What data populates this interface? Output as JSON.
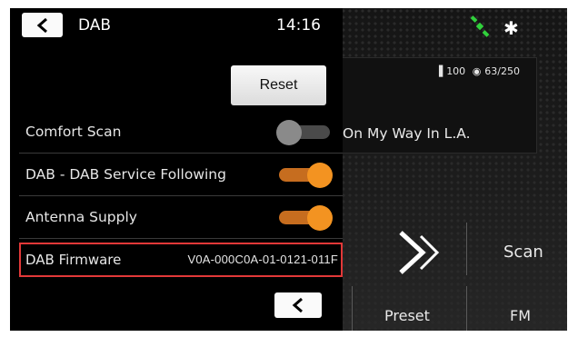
{
  "status_bar": {
    "title": "DAB",
    "time": "14:16"
  },
  "settings": {
    "reset_label": "Reset",
    "rows": [
      {
        "label": "Comfort Scan",
        "state": "off"
      },
      {
        "label": "DAB - DAB Service Following",
        "state": "on"
      },
      {
        "label": "Antenna Supply",
        "state": "on"
      }
    ],
    "firmware": {
      "label": "DAB Firmware",
      "value": "V0A-000C0A-01-0121-011F"
    }
  },
  "radio": {
    "signal": "100",
    "channel": "63/250",
    "song": "On My Way In L.A.",
    "scan_label": "Scan",
    "preset_label": "Preset",
    "band_label": "FM"
  },
  "colors": {
    "accent": "#f39321",
    "highlight_border": "#e23838"
  }
}
